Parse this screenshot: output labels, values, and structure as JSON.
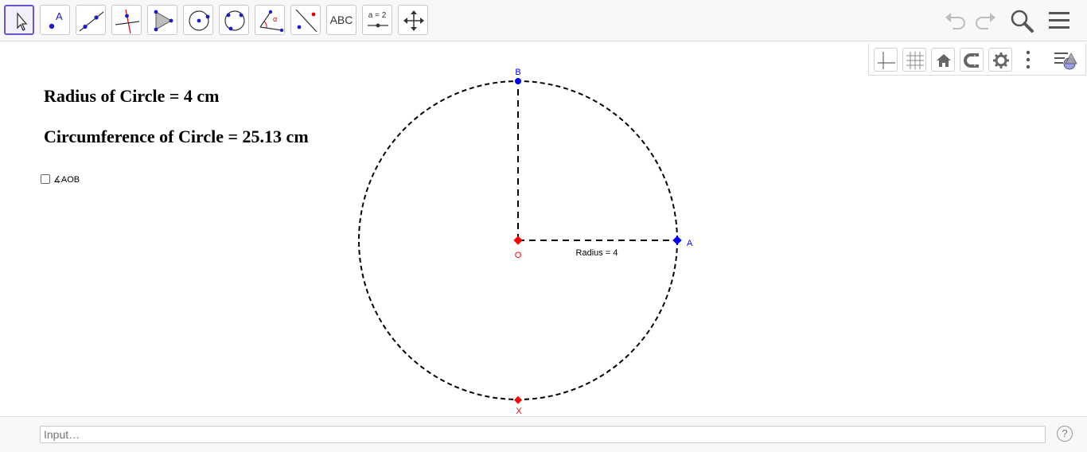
{
  "toolbar": {
    "tools": [
      {
        "name": "move-tool",
        "label": ""
      },
      {
        "name": "point-tool",
        "label": "A"
      },
      {
        "name": "line-tool",
        "label": ""
      },
      {
        "name": "perpendicular-line-tool",
        "label": ""
      },
      {
        "name": "polygon-tool",
        "label": ""
      },
      {
        "name": "circle-center-point-tool",
        "label": ""
      },
      {
        "name": "circle-three-points-tool",
        "label": ""
      },
      {
        "name": "angle-tool",
        "label": "α"
      },
      {
        "name": "reflect-tool",
        "label": ""
      },
      {
        "name": "text-tool",
        "label": "ABC"
      },
      {
        "name": "slider-tool",
        "label": "a = 2"
      },
      {
        "name": "move-graphics-view-tool",
        "label": ""
      }
    ]
  },
  "text": {
    "radius_line": "Radius of Circle = 4 cm",
    "circumference_line": "Circumference of Circle = 25.13 cm",
    "checkbox_label": "∡AOB"
  },
  "construction": {
    "radius_value": 4,
    "circumference_value": 25.13,
    "points": {
      "A": "A",
      "B": "B",
      "O": "O",
      "X": "X"
    },
    "segment_label": "Radius = 4"
  },
  "input": {
    "placeholder": "Input…",
    "help": "?"
  },
  "colors": {
    "accent": "#6557d2",
    "point_blue": "#0000ff",
    "point_red": "#ff0000"
  }
}
